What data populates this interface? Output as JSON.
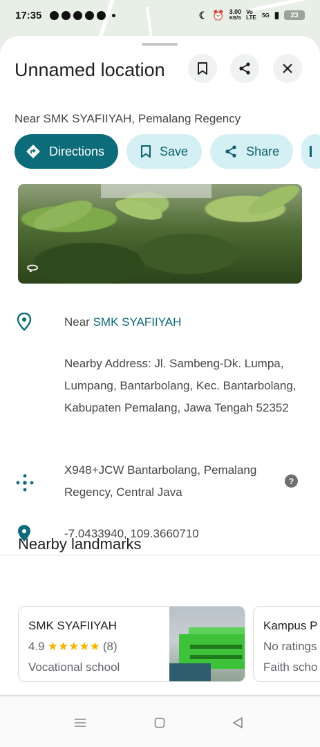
{
  "status_bar": {
    "time": "17:35",
    "speed_value": "3.00",
    "speed_unit": "KB/S",
    "network": "5G",
    "volte": "Vo LTE",
    "battery": "23"
  },
  "place": {
    "title": "Unnamed location",
    "subtitle": "Near SMK SYAFIIYAH, Pemalang Regency"
  },
  "actions": {
    "directions": "Directions",
    "save": "Save",
    "share": "Share"
  },
  "photo": {
    "badge_icon": "360-icon"
  },
  "details": {
    "near_prefix": "Near ",
    "near_link": "SMK SYAFIIYAH",
    "nearby_address": "Nearby Address: Jl. Sambeng-Dk. Lumpa, Lumpang, Bantarbolang, Kec. Bantarbolang, Kabupaten Pemalang, Jawa Tengah 52352",
    "plus_code": "X948+JCW Bantarbolang, Pemalang Regency, Central Java",
    "coordinates": "-7.0433940, 109.3660710"
  },
  "nearby": {
    "title": "Nearby landmarks",
    "cards": [
      {
        "name": "SMK SYAFIIYAH",
        "rating": "4.9",
        "stars": "★★★★★",
        "count": "(8)",
        "type": "Vocational school"
      },
      {
        "name": "Kampus P",
        "rating": "No ratings",
        "type": "Faith scho"
      }
    ]
  },
  "colors": {
    "accent": "#0d6c7a",
    "chip_bg": "#d5f0f5",
    "star": "#f4b400"
  }
}
